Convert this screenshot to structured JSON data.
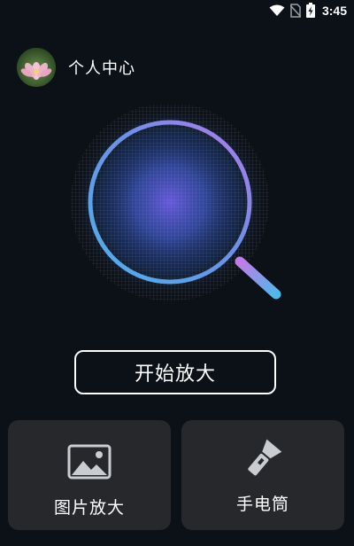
{
  "status_bar": {
    "time": "3:45",
    "icons": [
      "wifi-icon",
      "no-sim-icon",
      "battery-charging-icon"
    ]
  },
  "header": {
    "avatar_icon": "lotus-flower-avatar",
    "title": "个人中心"
  },
  "magnifier": {
    "icon": "magnifier-graphic",
    "colors": {
      "ring_start": "#4fb0ea",
      "ring_end": "#b07be8",
      "lens_glow": "#6a5ce0"
    }
  },
  "main": {
    "start_button_label": "开始放大"
  },
  "features": [
    {
      "label": "图片放大",
      "icon": "image-icon"
    },
    {
      "label": "手电筒",
      "icon": "flashlight-icon"
    }
  ],
  "colors": {
    "background": "#0c1017",
    "card": "#26282c",
    "text": "#ffffff"
  }
}
